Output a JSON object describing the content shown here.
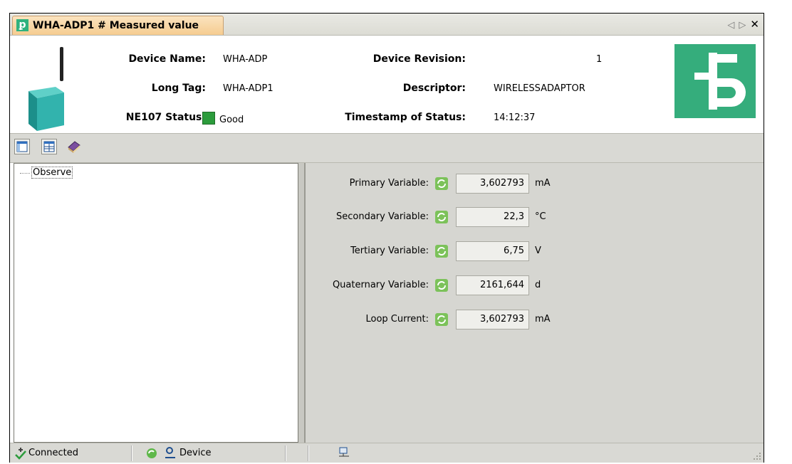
{
  "tab": {
    "title": "WHA-ADP1 # Measured value",
    "logo": "pf-logo-icon"
  },
  "header": {
    "device_name_label": "Device Name:",
    "device_name": "WHA-ADP",
    "long_tag_label": "Long Tag:",
    "long_tag": "WHA-ADP1",
    "ne107_label": "NE107 Status:",
    "ne107_value": "Good",
    "ne107_color": "#2c9c3c",
    "device_revision_label": "Device Revision:",
    "device_revision": "1",
    "descriptor_label": "Descriptor:",
    "descriptor": "WIRELESSADAPTOR",
    "timestamp_label": "Timestamp of Status:",
    "timestamp": "14:12:37"
  },
  "tree": {
    "items": [
      {
        "label": "Observe"
      }
    ]
  },
  "variables": [
    {
      "label": "Primary Variable:",
      "value": "3,602793",
      "unit": "mA"
    },
    {
      "label": "Secondary Variable:",
      "value": "22,3",
      "unit": "°C"
    },
    {
      "label": "Tertiary Variable:",
      "value": "6,75",
      "unit": "V"
    },
    {
      "label": "Quaternary Variable:",
      "value": "2161,644",
      "unit": "d"
    },
    {
      "label": "Loop Current:",
      "value": "3,602793",
      "unit": "mA"
    }
  ],
  "statusbar": {
    "connection": "Connected",
    "device": "Device"
  },
  "colors": {
    "brand_green": "#35ad7c",
    "tab_orange": "#f5cc90"
  }
}
